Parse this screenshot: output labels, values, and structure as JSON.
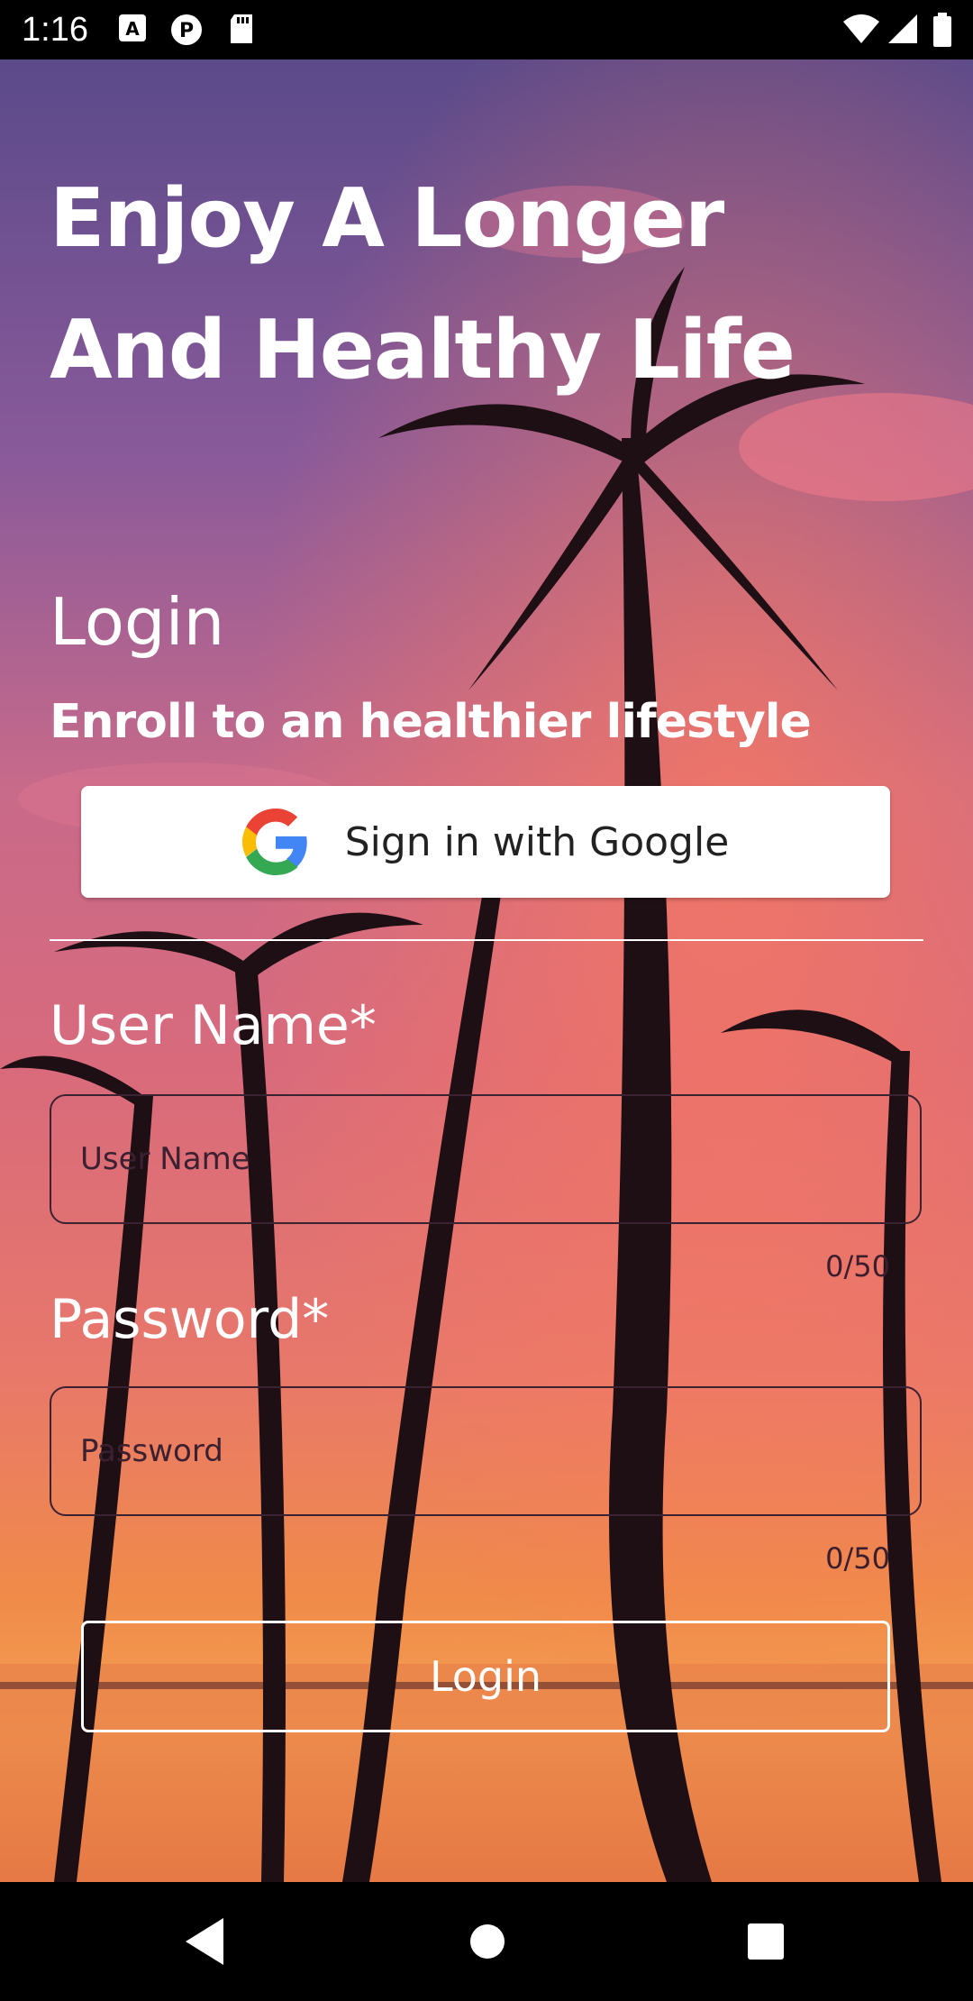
{
  "status_bar": {
    "time": "1:16",
    "icons": [
      "font-a-icon",
      "notification-p-icon",
      "sd-card-icon",
      "wifi-icon",
      "signal-icon",
      "battery-icon"
    ]
  },
  "headline": {
    "line1": "Enjoy A Longer",
    "line2": "And Healthy Life"
  },
  "login": {
    "title": "Login",
    "subtitle": "Enroll to an healthier lifestyle"
  },
  "google_button": {
    "label": "Sign in with Google"
  },
  "fields": {
    "username": {
      "label": "User Name*",
      "placeholder": "User Name",
      "value": "",
      "counter": "0/50"
    },
    "password": {
      "label": "Password*",
      "placeholder": "Password",
      "value": "",
      "counter": "0/50"
    }
  },
  "login_button": {
    "label": "Login"
  },
  "nav_bar": {
    "icons": [
      "back-icon",
      "home-icon",
      "recents-icon"
    ]
  },
  "colors": {
    "sky_top": "#5b4a8a",
    "sunset_pink": "#e0607a",
    "sunset_orange": "#f08a4a",
    "text": "#ffffff"
  }
}
